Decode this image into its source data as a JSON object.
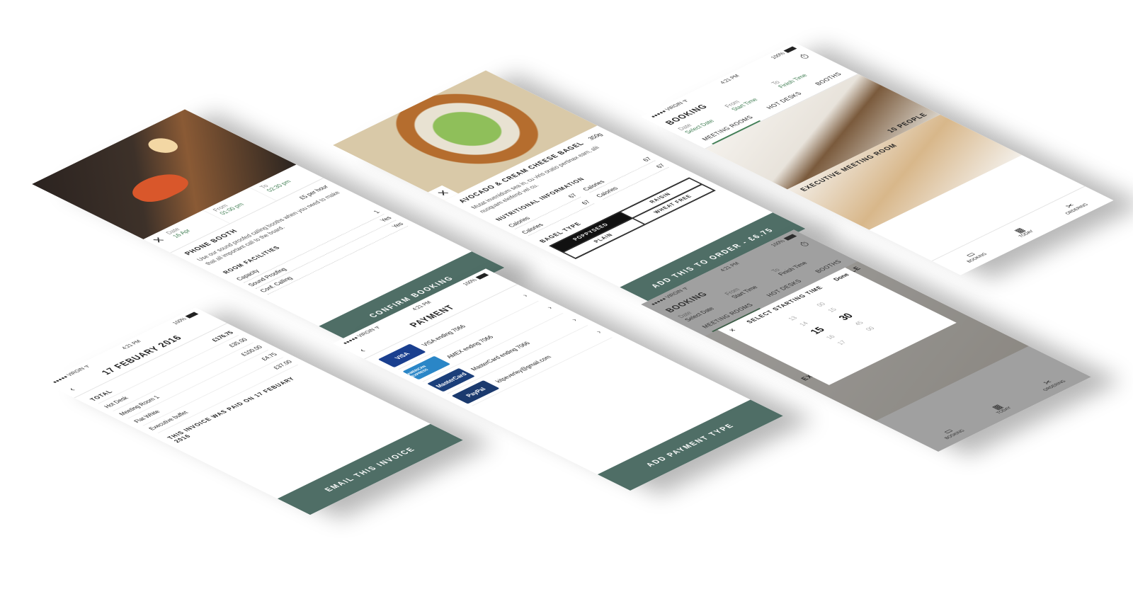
{
  "status": {
    "carrier": "●●●●● VIRGIN ᯤ",
    "time": "4:21 PM",
    "battery": "100%"
  },
  "phone_booth": {
    "date_label": "Date",
    "date_value": "16 Apr",
    "from_label": "From",
    "from_value": "01:00 pm",
    "to_label": "To",
    "to_value": "02:30 pm",
    "title": "PHONE BOOTH",
    "price": "£5 per hour",
    "description": "Use our sound proofed calling booths when you need to make that all important call to the board.",
    "facilities_title": "ROOM FACILITIES",
    "facilities": [
      {
        "label": "Capacity",
        "value": "1"
      },
      {
        "label": "Sound Proofing",
        "value": "Yes"
      },
      {
        "label": "Conf. Calling",
        "value": "Yes"
      }
    ],
    "cta": "CONFIRM BOOKING"
  },
  "bagel": {
    "title": "AVOCADO & CREAM CHEESE BAGEL",
    "weight": "350g",
    "description": "Mutat invenidum sea in, cu viris oratio pertinax eam, alii nusquam eleifend vel cu.",
    "nutrition_title": "NUTRITIONAL INFORMATION",
    "nutrition": [
      {
        "label": "Calories",
        "value": "67"
      },
      {
        "label": "Calories",
        "value": "67"
      },
      {
        "label": "Calories",
        "value": "67"
      },
      {
        "label": "Calories",
        "value": "67"
      }
    ],
    "bagel_type_title": "BAGEL TYPE",
    "options": [
      "POPPYSEED",
      "RAISIN",
      "PLAIN",
      "WHEAT FREE"
    ],
    "cta": "ADD THIS TO ORDER - £6.75"
  },
  "booking": {
    "title": "BOOKING",
    "date_label": "Date",
    "date_value": "Select Date",
    "from_label": "From",
    "from_value": "Start Time",
    "to_label": "To",
    "to_value": "Finish Time",
    "tabs": [
      "MEETING ROOMS",
      "HOT DESKS",
      "BOOTHS"
    ],
    "rooms": [
      {
        "name": "10 PEOPLE"
      },
      {
        "name": "EXECUTIVE MEETING ROOM"
      }
    ],
    "nav": [
      "BOOKING",
      "TODAY",
      "ORDERING"
    ]
  },
  "invoice": {
    "date": "17 FEBUARY 2016",
    "total_label": "TOTAL",
    "total_value": "£176.75",
    "lines": [
      {
        "label": "Hot Desk",
        "value": "£35.00"
      },
      {
        "label": "Meeting Room 1",
        "value": "£100.00"
      },
      {
        "label": "Flat White",
        "value": "£4.75"
      },
      {
        "label": "Executive buffet",
        "value": "£37.00"
      }
    ],
    "paid_note": "THIS INVOICE WAS PAID ON 17 FEBUARY 2016",
    "cta": "EMAIL THIS INVOICE"
  },
  "payment": {
    "title": "PAYMENT",
    "methods": [
      {
        "logo": "VISA",
        "label": "VISA ending 7066",
        "color": "#1a3f8f"
      },
      {
        "logo": "AMERICAN EXPRESS",
        "label": "AMEX ending 7066",
        "color": "#2a86c7"
      },
      {
        "logo": "MasterCard",
        "label": "MasterCard ending 7066",
        "color": "#1b3f7a"
      },
      {
        "logo": "PayPal",
        "label": "kitpeverley@gmail.com",
        "color": "#1b3a6e"
      }
    ],
    "cta": "ADD PAYMENT TYPE"
  },
  "picker": {
    "title": "SELECT STARTING TIME",
    "done": "Done",
    "hours": [
      "13",
      "14",
      "15",
      "16",
      "17"
    ],
    "minutes": [
      "00",
      "15",
      "30",
      "45",
      "00"
    ],
    "bg_title": "BOOKING",
    "bg_date_label": "Date",
    "bg_date_value": "Select Date",
    "bg_from_label": "From",
    "bg_from_value": "Start Time",
    "bg_to_label": "To",
    "bg_to_value": "Finish Time",
    "bg_tabs": [
      "MEETING ROOMS",
      "HOT DESKS",
      "BOOTHS"
    ],
    "bg_people": "PLE",
    "bg_room": "EXEC",
    "bg_nav": [
      "BOOKING",
      "TODAY",
      "ORDERING"
    ]
  },
  "colors": {
    "accent_green": "#3f7d52",
    "cta": "#4f6e66"
  }
}
